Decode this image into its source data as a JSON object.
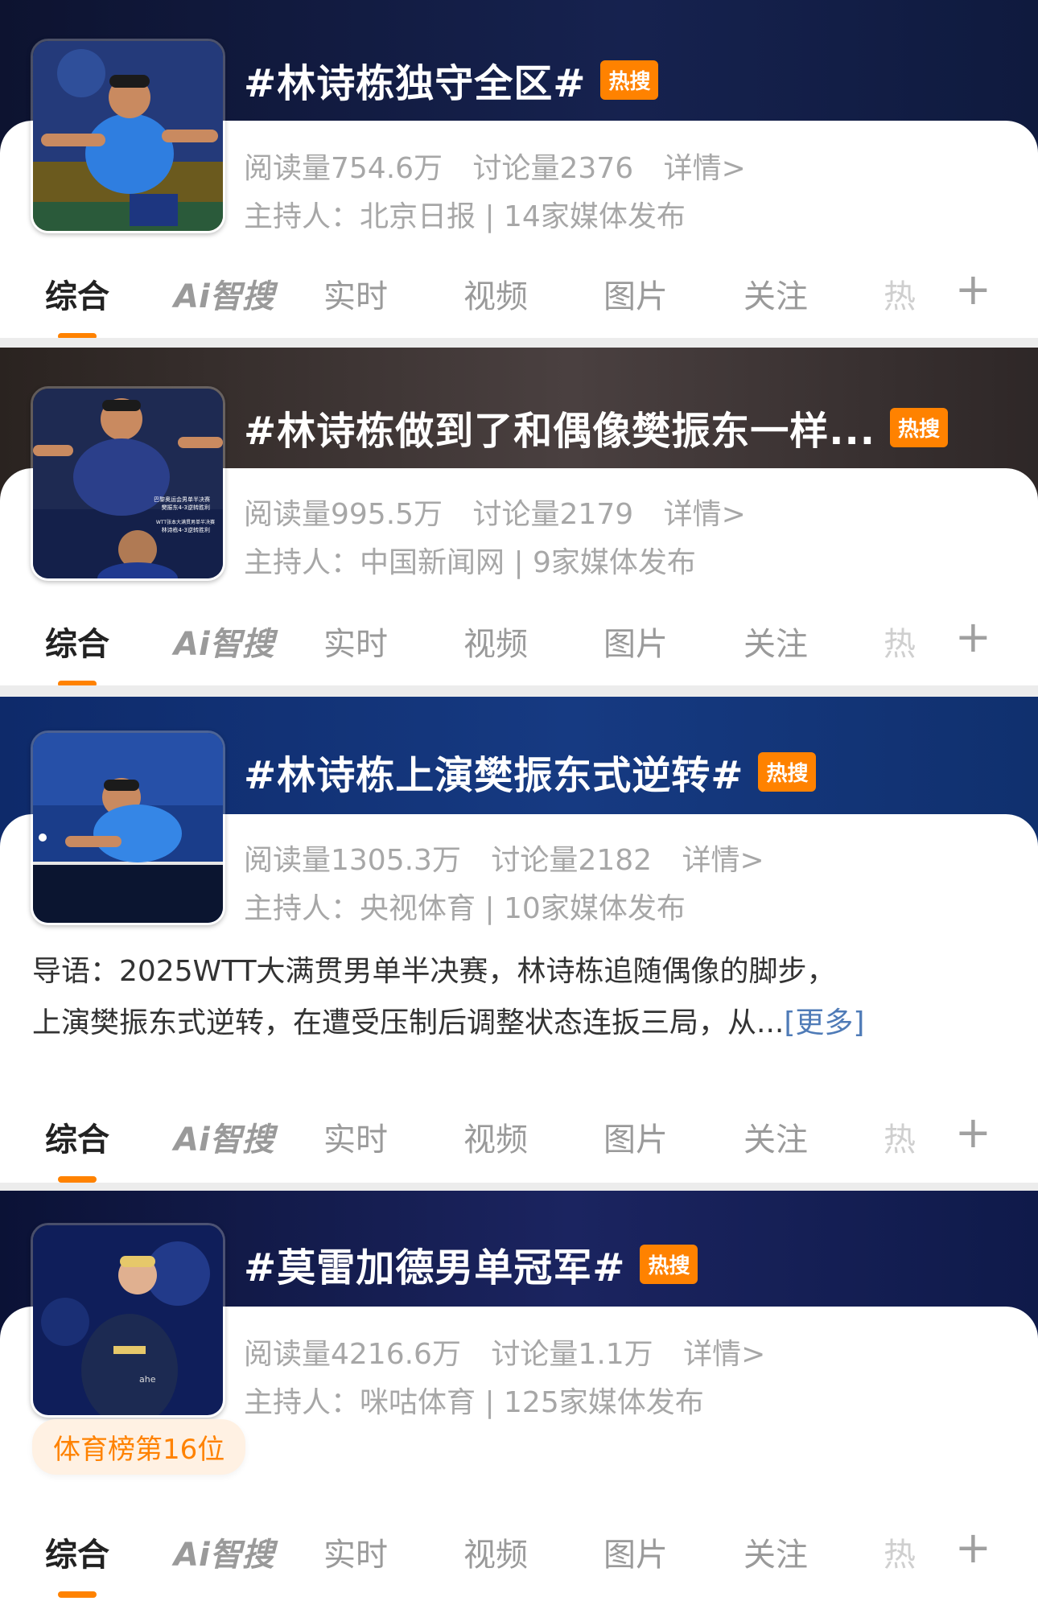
{
  "tabs": [
    "综合",
    "Ai智搜",
    "实时",
    "视频",
    "图片",
    "关注",
    "热"
  ],
  "plus": "+",
  "topics": [
    {
      "title": "#林诗栋独守全区#",
      "badge": "热搜",
      "reads": "阅读量754.6万",
      "discussions": "讨论量2376",
      "details": "详情>",
      "host": "主持人：北京日报 | 14家媒体发布",
      "thumb_icon": "table-tennis-player-photo"
    },
    {
      "title": "#林诗栋做到了和偶像樊振东一样...",
      "badge": "热搜",
      "reads": "阅读量995.5万",
      "discussions": "讨论量2179",
      "details": "详情>",
      "host": "主持人：中国新闻网 | 9家媒体发布",
      "thumb_captions": [
        "巴黎奥运会男单半决赛",
        "樊振东4-3逆转胜利",
        "WTT张本大满贯男单半决赛",
        "林诗栋4-3逆转胜利"
      ]
    },
    {
      "title": "#林诗栋上演樊振东式逆转#",
      "badge": "热搜",
      "reads": "阅读量1305.3万",
      "discussions": "讨论量2182",
      "details": "详情>",
      "host": "主持人：央视体育 | 10家媒体发布",
      "intro_line1": "导语：2025WTT大满贯男单半决赛，林诗栋追随偶像的脚步，",
      "intro_line2": "上演樊振东式逆转，在遭受压制后调整状态连扳三局，从...",
      "more": "[更多]"
    },
    {
      "title": "#莫雷加德男单冠军#",
      "badge": "热搜",
      "reads": "阅读量4216.6万",
      "discussions": "讨论量1.1万",
      "details": "详情>",
      "host": "主持人：咪咕体育 | 125家媒体发布",
      "rank": "体育榜第16位"
    }
  ],
  "colors": {
    "accent": "#ff8200",
    "link": "#4f7bb7",
    "muted": "#a7a7a7"
  }
}
